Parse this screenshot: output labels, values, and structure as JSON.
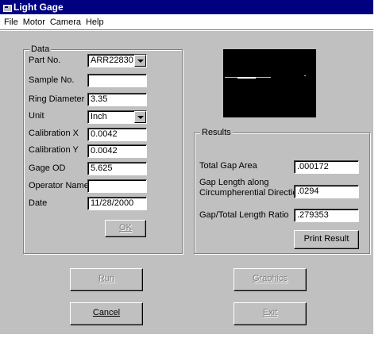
{
  "window": {
    "title": "Light Gage"
  },
  "menu": [
    "File",
    "Motor",
    "Camera",
    "Help"
  ],
  "data_group": {
    "legend": "Data",
    "part_no": {
      "label": "Part No.",
      "value": "ARR22830"
    },
    "sample_no": {
      "label": "Sample No.",
      "value": ""
    },
    "ring_diameter": {
      "label": "Ring Diameter",
      "value": "3.35"
    },
    "unit": {
      "label": "Unit",
      "value": "Inch"
    },
    "calibration_x": {
      "label": "Calibration X",
      "value": "0.0042"
    },
    "calibration_y": {
      "label": "Calibration Y",
      "value": "0.0042"
    },
    "gage_od": {
      "label": "Gage OD",
      "value": "5.625"
    },
    "operator_name": {
      "label": "Operator Name",
      "value": ""
    },
    "date": {
      "label": "Date",
      "value": "11/28/2000"
    },
    "ok_button": {
      "label": "OK",
      "enabled": false
    }
  },
  "results_group": {
    "legend": "Results",
    "total_gap_area": {
      "label": "Total Gap Area",
      "value": ".000172"
    },
    "gap_length": {
      "label_line1": "Gap Length along",
      "label_line2": "Circumpherential Direction",
      "value": ".0294"
    },
    "gap_ratio": {
      "label": "Gap/Total Length Ratio",
      "value": ".279353"
    },
    "print_button": {
      "label": "Print Result",
      "enabled": true
    }
  },
  "buttons": {
    "run": {
      "label": "Run",
      "enabled": false
    },
    "graphics": {
      "label": "Graphics",
      "enabled": false
    },
    "cancel": {
      "label": "Cancel",
      "enabled": true
    },
    "exit": {
      "label": "Exit",
      "enabled": false
    }
  },
  "colors": {
    "titlebar": "#000080",
    "face": "#c0c0c0",
    "disabled_text": "#808080"
  }
}
